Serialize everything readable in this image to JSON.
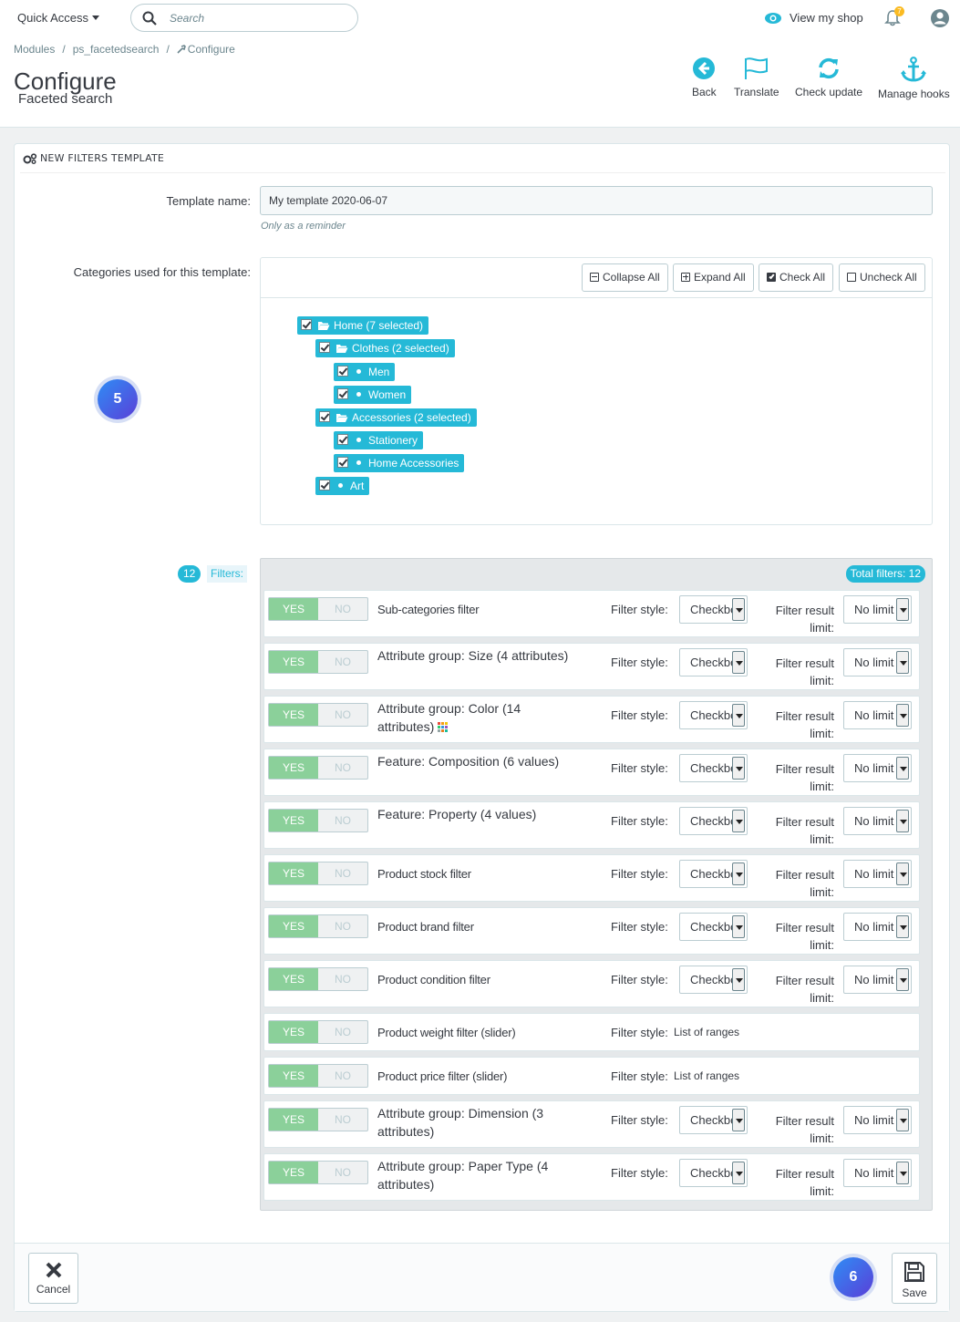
{
  "topbar": {
    "quick_access": "Quick Access",
    "search_placeholder": "Search",
    "view_shop": "View my shop",
    "notif_count": "7"
  },
  "header": {
    "breadcrumbs": [
      "Modules",
      "ps_facetedsearch",
      "Configure"
    ],
    "title": "Configure",
    "subtitle": "Faceted search",
    "toolbar": {
      "back": "Back",
      "translate": "Translate",
      "check_update": "Check update",
      "manage_hooks": "Manage hooks"
    }
  },
  "panel": {
    "heading": "NEW FILTERS TEMPLATE",
    "template_name_label": "Template name:",
    "template_name_value": "My template 2020-06-07",
    "template_hint": "Only as a reminder",
    "categories_label": "Categories used for this template:",
    "tree_buttons": {
      "collapse": "Collapse All",
      "expand": "Expand All",
      "check": "Check All",
      "uncheck": "Uncheck All"
    },
    "tree": [
      {
        "label": "Home (7 selected)",
        "level": 0,
        "folder": true
      },
      {
        "label": "Clothes (2 selected)",
        "level": 1,
        "folder": true
      },
      {
        "label": "Men",
        "level": 2,
        "folder": false
      },
      {
        "label": "Women",
        "level": 2,
        "folder": false
      },
      {
        "label": "Accessories (2 selected)",
        "level": 1,
        "folder": true
      },
      {
        "label": "Stationery",
        "level": 2,
        "folder": false
      },
      {
        "label": "Home Accessories",
        "level": 2,
        "folder": false
      },
      {
        "label": "Art",
        "level": 1,
        "folder": false
      }
    ],
    "step_a": "5",
    "step_b": "6",
    "filters_count": "12",
    "filters_label": "Filters:",
    "total_filters": "Total filters: 12",
    "yes": "YES",
    "no": "NO",
    "filter_style_label": "Filter style:",
    "limit_label": "Filter result limit:",
    "select_style": "Checkbox",
    "select_limit": "No limit",
    "filters": [
      {
        "name": "Sub-categories filter",
        "style": "select"
      },
      {
        "name": "Attribute group: Size (4 attributes)",
        "style": "select"
      },
      {
        "name": "Attribute group: Color (14 attributes)",
        "style": "select",
        "color_icon": true
      },
      {
        "name": "Feature: Composition (6 values)",
        "style": "select"
      },
      {
        "name": "Feature: Property (4 values)",
        "style": "select"
      },
      {
        "name": "Product stock filter",
        "style": "select"
      },
      {
        "name": "Product brand filter",
        "style": "select"
      },
      {
        "name": "Product condition filter",
        "style": "select"
      },
      {
        "name": "Product weight filter (slider)",
        "style": "List of ranges"
      },
      {
        "name": "Product price filter (slider)",
        "style": "List of ranges"
      },
      {
        "name": "Attribute group: Dimension (3 attributes)",
        "style": "select"
      },
      {
        "name": "Attribute group: Paper Type (4 attributes)",
        "style": "select"
      }
    ],
    "cancel": "Cancel",
    "save": "Save"
  },
  "colors": {
    "accent": "#25b9d7",
    "switch_on": "#8bd09a"
  }
}
